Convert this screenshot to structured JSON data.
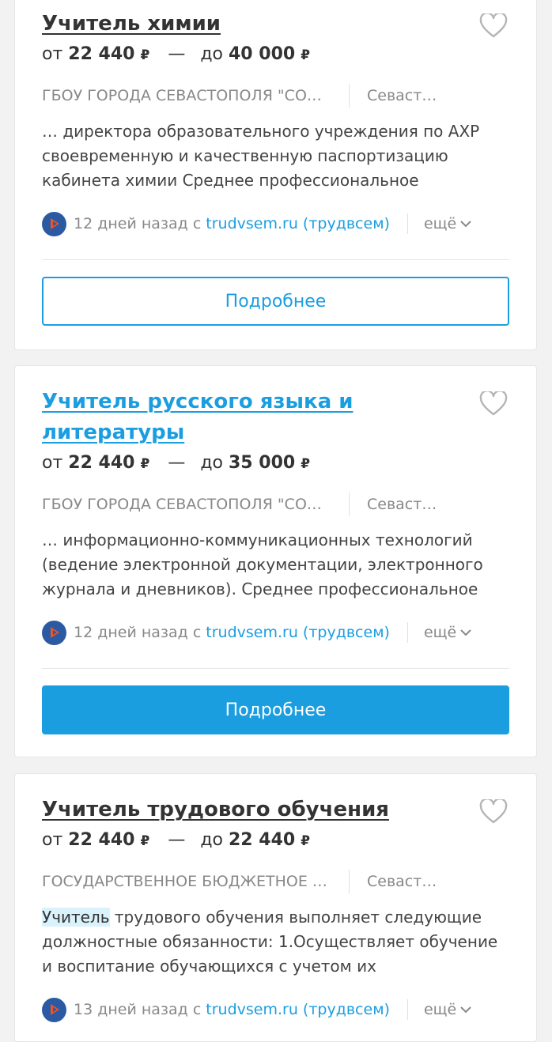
{
  "currency": "₽",
  "labels": {
    "from": "от",
    "to": "до",
    "dash": "—",
    "details": "Подробнее",
    "more": "ещё"
  },
  "jobs": [
    {
      "title": "Учитель химии",
      "salary_from": "22 440",
      "salary_to": "40 000",
      "company": "ГБОУ ГОРОДА СЕВАСТОПОЛЯ \"СО…",
      "city": "Севаст…",
      "description": "… директора образовательного учреждения по АХР своевременную и качественную паспортизацию кабинета химии Среднее профессиональное",
      "posted": "12 дней назад с",
      "source": "trudvsem.ru (трудвсем)"
    },
    {
      "title": "Учитель русского языка и литературы",
      "salary_from": "22 440",
      "salary_to": "35 000",
      "company": "ГБОУ ГОРОДА СЕВАСТОПОЛЯ \"СО…",
      "city": "Севаст…",
      "description": "… информационно-коммуникационных технологий (ведение электронной документации, электронного журнала и дневников). Среднее профессиональное",
      "posted": "12 дней назад с",
      "source": "trudvsem.ru (трудвсем)"
    },
    {
      "title": "Учитель трудового обучения",
      "salary_from": "22 440",
      "salary_to": "22 440",
      "company": "ГОСУДАРСТВЕННОЕ БЮДЖЕТНОЕ …",
      "city": "Севаст…",
      "description_highlight": "Учитель",
      "description_rest": " трудового обучения выполняет следующие должностные обязанности: 1.Осуществляет обучение и воспитание обучающихся с учетом их",
      "posted": "13 дней назад с",
      "source": "trudvsem.ru (трудвсем)"
    }
  ]
}
